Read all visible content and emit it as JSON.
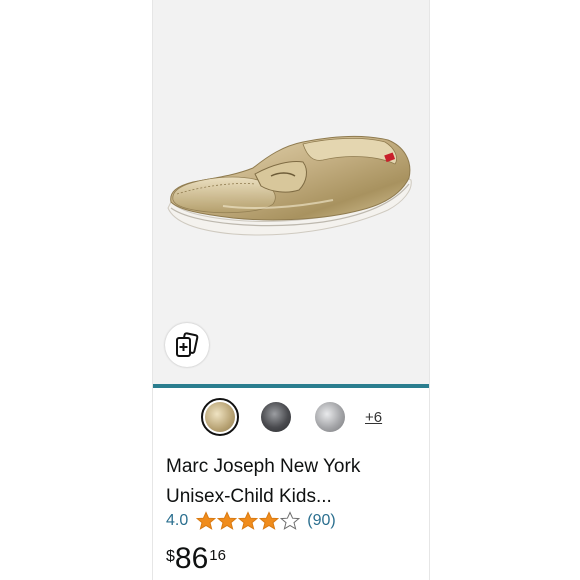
{
  "product": {
    "title_line1": "Marc Joseph New York",
    "title_line2": "Unisex-Child Kids...",
    "image_alt": "metallic gold penny loafer shoe"
  },
  "image_button": {
    "icon": "add-to-cart-cards-icon"
  },
  "colors": {
    "accent_divider": "#2b7e8f",
    "star_fill": "#f08c1c",
    "link": "#2b6f8f"
  },
  "swatches": {
    "options": [
      {
        "name": "gold",
        "color": "#c8b98f",
        "selected": true
      },
      {
        "name": "gunmetal",
        "color": "#55565a",
        "selected": false
      },
      {
        "name": "silver",
        "color": "#a9aaad",
        "selected": false
      }
    ],
    "more_label": "+6"
  },
  "rating": {
    "value": "4.0",
    "stars": 4,
    "max_stars": 5,
    "review_count": "(90)"
  },
  "price": {
    "symbol": "$",
    "whole": "86",
    "fraction": "16"
  }
}
